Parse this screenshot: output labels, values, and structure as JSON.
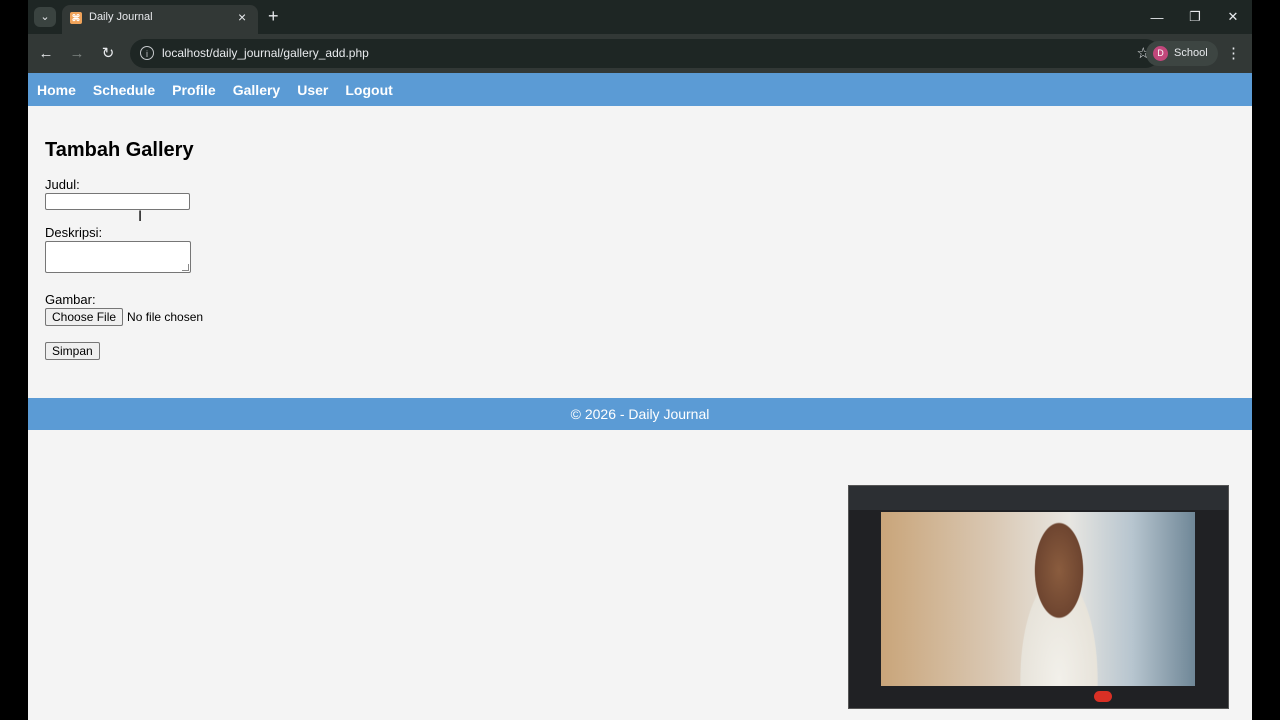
{
  "browser": {
    "tab_title": "Daily Journal",
    "url": "localhost/daily_journal/gallery_add.php",
    "profile_initial": "D",
    "profile_label": "School",
    "icons": {
      "tab_search": "chevron-down-icon",
      "tab_close": "close-icon",
      "new_tab": "plus-icon",
      "back": "arrow-left-icon",
      "forward": "arrow-right-icon",
      "reload": "reload-icon",
      "site_info": "info-icon",
      "bookmark": "star-icon",
      "menu": "kebab-menu-icon",
      "minimize": "minimize-icon",
      "restore": "restore-icon",
      "close_window": "close-icon"
    }
  },
  "nav": {
    "items": [
      {
        "label": "Home"
      },
      {
        "label": "Schedule"
      },
      {
        "label": "Profile"
      },
      {
        "label": "Gallery"
      },
      {
        "label": "User"
      },
      {
        "label": "Logout"
      }
    ]
  },
  "form": {
    "title": "Tambah Gallery",
    "judul_label": "Judul:",
    "judul_value": "",
    "deskripsi_label": "Deskripsi:",
    "deskripsi_value": "",
    "gambar_label": "Gambar:",
    "choose_file_label": "Choose File",
    "file_status": "No file chosen",
    "submit_label": "Simpan"
  },
  "footer": {
    "text": "© 2026 - Daily Journal"
  },
  "colors": {
    "nav_bg": "#5b9bd5",
    "page_bg": "#f4f4f4",
    "browser_bg": "#1e2624"
  }
}
